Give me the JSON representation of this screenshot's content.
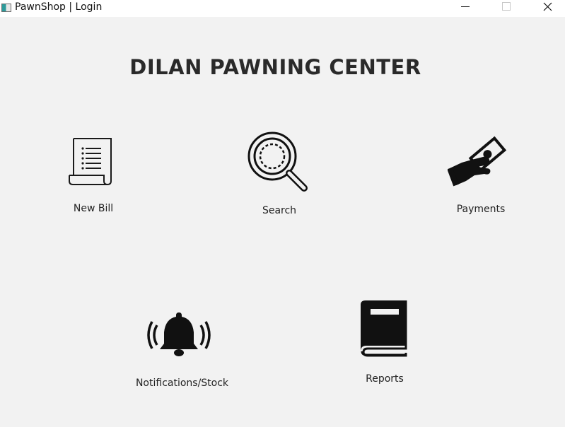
{
  "window": {
    "title": "PawnShop | Login"
  },
  "header": {
    "title": "DILAN PAWNING CENTER"
  },
  "menu": {
    "new_bill": {
      "label": "New Bill",
      "icon": "receipt-icon"
    },
    "search": {
      "label": "Search",
      "icon": "magnifier-icon"
    },
    "payments": {
      "label": "Payments",
      "icon": "hand-money-icon"
    },
    "notifications": {
      "label": "Notifications/Stock",
      "icon": "bell-icon"
    },
    "reports": {
      "label": "Reports",
      "icon": "book-icon"
    }
  }
}
